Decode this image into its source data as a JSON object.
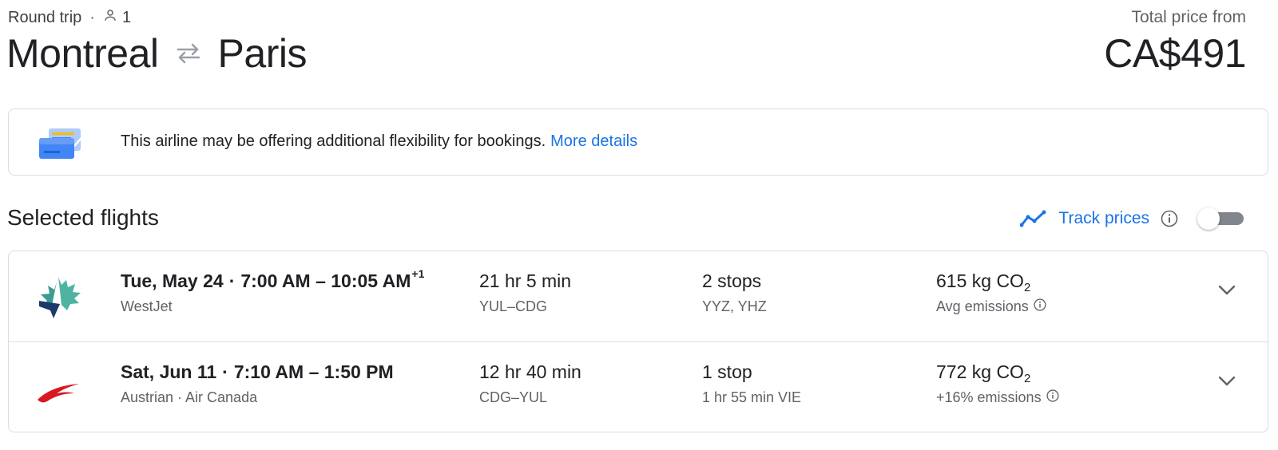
{
  "header": {
    "trip_type": "Round trip",
    "dot": "·",
    "passengers": "1",
    "origin": "Montreal",
    "destination": "Paris",
    "price_label": "Total price from",
    "price": "CA$491"
  },
  "banner": {
    "text": "This airline may be offering additional flexibility for bookings.",
    "link": "More details"
  },
  "section": {
    "title": "Selected flights",
    "track_label": "Track prices",
    "track_enabled": false
  },
  "flights": [
    {
      "date": "Tue, May 24",
      "times": "7:00 AM – 10:05 AM",
      "day_offset": "+1",
      "airline": "WestJet",
      "duration": "21 hr 5 min",
      "route": "YUL–CDG",
      "stops": "2 stops",
      "stop_detail": "YYZ, YHZ",
      "co2_value": "615 kg CO",
      "co2_sub": "2",
      "emissions": "Avg emissions"
    },
    {
      "date": "Sat, Jun 11",
      "times": "7:10 AM – 1:50 PM",
      "day_offset": "",
      "airline": "Austrian · Air Canada",
      "duration": "12 hr 40 min",
      "route": "CDG–YUL",
      "stops": "1 stop",
      "stop_detail": "1 hr 55 min VIE",
      "co2_value": "772 kg CO",
      "co2_sub": "2",
      "emissions": "+16% emissions"
    }
  ],
  "colors": {
    "accent": "#1a73e8",
    "text_primary": "#202124",
    "text_secondary": "#5f6368",
    "border": "#dadce0"
  }
}
